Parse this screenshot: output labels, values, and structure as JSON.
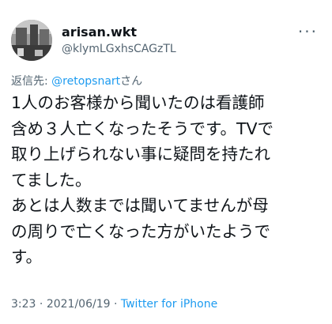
{
  "user": {
    "display_name": "arisan.wkt",
    "handle": "@klymLGxhsCAGzTL"
  },
  "more_icon": "more-icon",
  "reply": {
    "prefix": "返信先: ",
    "mention": "@retopsnart",
    "suffix": "さん"
  },
  "tweet": {
    "text": "1人のお客様から聞いたのは看護師\n含め３人亡くなったそうです。TVで\n取り上げられない事に疑問を持たれ\nてました。\nあとは人数までは聞いてませんが母\nの周りで亡くなった方がいたようで\nす。"
  },
  "meta": {
    "time": "3:23",
    "separator": " · ",
    "date": "2021/06/19",
    "source": "Twitter for iPhone"
  },
  "colors": {
    "link": "#1d9bf0",
    "secondary": "#536471",
    "text": "#0f1419"
  }
}
